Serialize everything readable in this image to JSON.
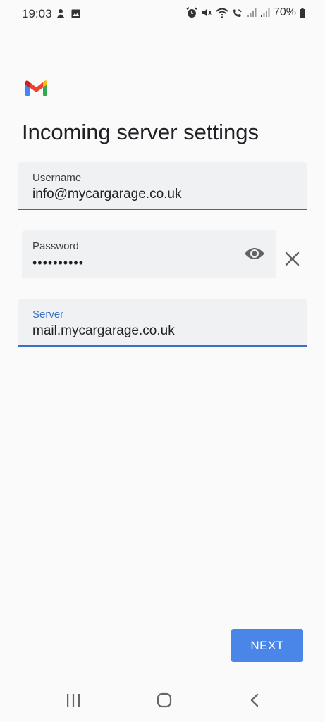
{
  "status_bar": {
    "time": "19:03",
    "battery_percent": "70%",
    "icons": [
      "notification-icon",
      "image-icon",
      "alarm-icon",
      "mute-icon",
      "wifi-icon",
      "wifi-call-icon",
      "signal-icon",
      "signal-icon",
      "battery-icon"
    ]
  },
  "app": {
    "logo": "gmail-logo"
  },
  "page": {
    "title": "Incoming server settings"
  },
  "form": {
    "username": {
      "label": "Username",
      "value": "info@mycargarage.co.uk"
    },
    "password": {
      "label": "Password",
      "value": "••••••••••",
      "toggle_icon": "eye-icon",
      "clear_icon": "close-icon"
    },
    "server": {
      "label": "Server",
      "value": "mail.mycargarage.co.uk",
      "focused": true
    }
  },
  "actions": {
    "next_label": "NEXT"
  },
  "nav_bar": {
    "icons": [
      "recents-icon",
      "home-icon",
      "back-icon"
    ]
  },
  "colors": {
    "accent": "#4a86e8",
    "focus": "#3a6fcb",
    "field_bg": "#f0f1f2",
    "background": "#fafafa"
  }
}
